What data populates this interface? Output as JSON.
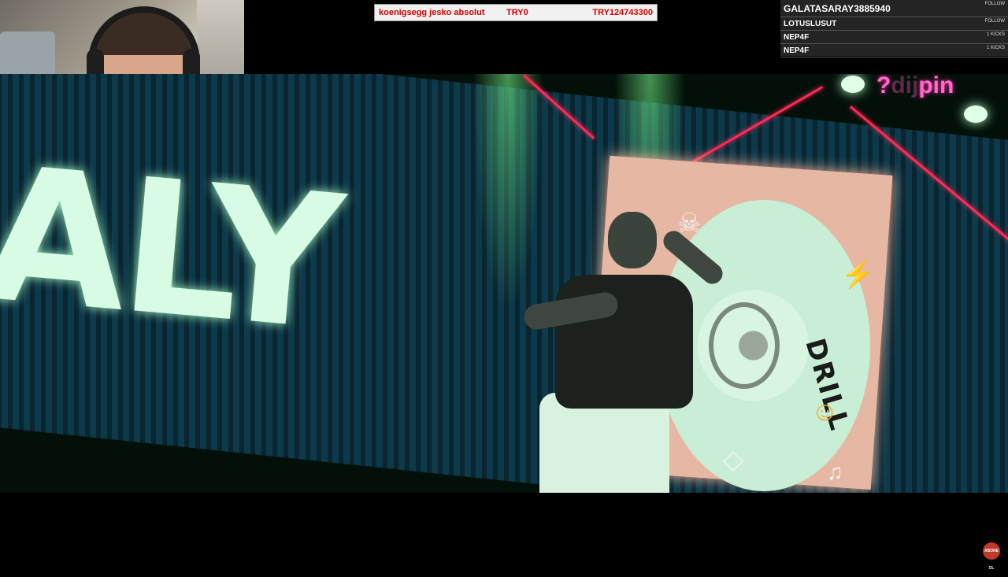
{
  "price_bar": {
    "item_name": "koenigsegg jesko absolut",
    "price_1": "TRY0",
    "price_2": "TRY124743300"
  },
  "events": [
    {
      "name": "GALATASARAY3885940",
      "tag": "FOLLOW"
    },
    {
      "name": "LOTUSLUSUT",
      "tag": "FOLLOW"
    },
    {
      "name": "NEP4F",
      "tag": "1 KICKS"
    },
    {
      "name": "NEP4F",
      "tag": "1 KICKS"
    }
  ],
  "video": {
    "screen_text": "ALY",
    "disc_text": "DRILL",
    "logo_prefix": "?",
    "logo_mid": "dij",
    "logo_suffix": "pin"
  },
  "icons": {
    "skull": "skull-icon",
    "lightning": "lightning-icon",
    "smiley": "smiley-icon",
    "diamond": "diamond-icon",
    "music_note": "music-note-icon"
  },
  "corner_badge": "ABONE OL",
  "colors": {
    "price_text": "#d10000",
    "logo": "#ff69c8",
    "laser": "#ff2a55"
  }
}
